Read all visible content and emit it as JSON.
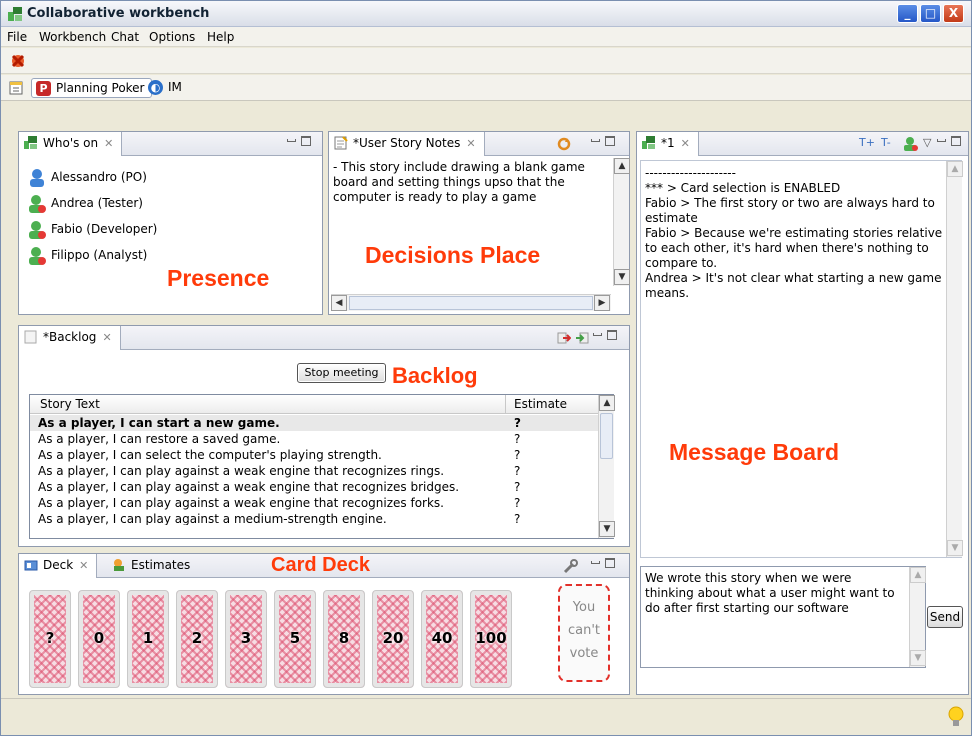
{
  "window": {
    "title": "Collaborative workbench"
  },
  "menu": [
    "File",
    "Workbench",
    "Chat",
    "Options",
    "Help"
  ],
  "perspectives": [
    {
      "label": "Planning Poker",
      "icon": "planning-poker-icon",
      "active": true
    },
    {
      "label": "IM",
      "icon": "im-icon",
      "active": false
    }
  ],
  "whos_on": {
    "tab": "Who's on",
    "people": [
      "Alessandro (PO)",
      "Andrea (Tester)",
      "Fabio (Developer)",
      "Filippo (Analyst)"
    ],
    "overlay_label": "Presence"
  },
  "notes": {
    "tab": "*User Story Notes",
    "text": "- This story include drawing a blank game board and setting things upso that the computer is ready to play a game",
    "overlay_label": "Decisions Place"
  },
  "backlog": {
    "tab": "*Backlog",
    "stop_button": "Stop meeting",
    "overlay_label": "Backlog",
    "columns": [
      "Story Text",
      "Estimate"
    ],
    "rows": [
      {
        "story": "As a player, I can start a new game.",
        "estimate": "?",
        "selected": true
      },
      {
        "story": "As a player, I can restore a saved game.",
        "estimate": "?"
      },
      {
        "story": "As a player, I can select the computer's playing strength.",
        "estimate": "?"
      },
      {
        "story": "As a player, I can play against a weak engine that recognizes rings.",
        "estimate": "?"
      },
      {
        "story": "As a player, I can play against a weak engine that recognizes bridges.",
        "estimate": "?"
      },
      {
        "story": "As a player, I can play against a weak engine that recognizes forks.",
        "estimate": "?"
      },
      {
        "story": "As a player, I can play against a medium-strength engine.",
        "estimate": "?"
      }
    ]
  },
  "deck": {
    "tabs": [
      "Deck",
      "Estimates"
    ],
    "overlay_label": "Card Deck",
    "cards": [
      "?",
      "0",
      "1",
      "2",
      "3",
      "5",
      "8",
      "20",
      "40",
      "100"
    ],
    "no_vote": [
      "You",
      "can't",
      "vote"
    ]
  },
  "chat": {
    "tab": "*1",
    "messages": "---------------------\n*** > Card selection is ENABLED\nFabio > The first story or two are always hard to estimate\nFabio > Because we're estimating stories relative to each other, it's hard when there's nothing to compare to.\nAndrea > It's not clear what starting a new game means.",
    "overlay_label": "Message Board",
    "input_value": "We wrote this story when we were thinking about what a user might want to do after first starting our software",
    "send_label": "Send"
  },
  "colors": {
    "overlay": "#ff3b0a",
    "accent": "#2557c7"
  }
}
